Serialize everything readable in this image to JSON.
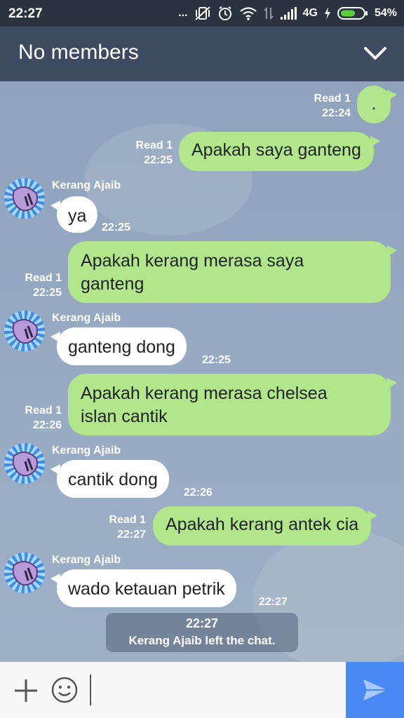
{
  "status_bar": {
    "time": "22:27",
    "dots": "...",
    "network": "4G",
    "battery": "54%"
  },
  "header": {
    "title": "No members"
  },
  "messages": [
    {
      "side": "me",
      "read": "Read 1",
      "time": "22:24",
      "text": "."
    },
    {
      "side": "me",
      "read": "Read 1",
      "time": "22:25",
      "text": "Apakah saya ganteng"
    },
    {
      "side": "them",
      "sender": "Kerang Ajaib",
      "time": "22:25",
      "text": "ya"
    },
    {
      "side": "me",
      "read": "Read 1",
      "time": "22:25",
      "text": "Apakah kerang merasa saya ganteng",
      "lines": [
        "Apakah kerang merasa saya",
        "ganteng"
      ]
    },
    {
      "side": "them",
      "sender": "Kerang Ajaib",
      "time": "22:25",
      "text": "ganteng dong"
    },
    {
      "side": "me",
      "read": "Read 1",
      "time": "22:26",
      "text": "Apakah kerang merasa chelsea islan cantik",
      "lines": [
        "Apakah kerang merasa chelsea",
        "islan cantik"
      ]
    },
    {
      "side": "them",
      "sender": "Kerang Ajaib",
      "time": "22:26",
      "text": "cantik dong"
    },
    {
      "side": "me",
      "read": "Read 1",
      "time": "22:27",
      "text": "Apakah kerang antek cia"
    },
    {
      "side": "them",
      "sender": "Kerang Ajaib",
      "time": "22:27",
      "text": "wado ketauan petrik"
    }
  ],
  "system_message": {
    "time": "22:27",
    "text": "Kerang Ajaib left the chat."
  },
  "input": {
    "value": "",
    "placeholder": ""
  },
  "colors": {
    "header_bg": "#3d4a5f",
    "status_bg": "#2b3340",
    "chat_bg": "#93a7c0",
    "my_bubble": "#b2e68a",
    "their_bubble": "#ffffff",
    "send_button": "#4a8af4"
  },
  "icons": {
    "header": "chevron-down-icon",
    "add": "plus-icon",
    "emoji": "smiley-icon",
    "send": "send-icon",
    "avatar": "shell-icon"
  }
}
